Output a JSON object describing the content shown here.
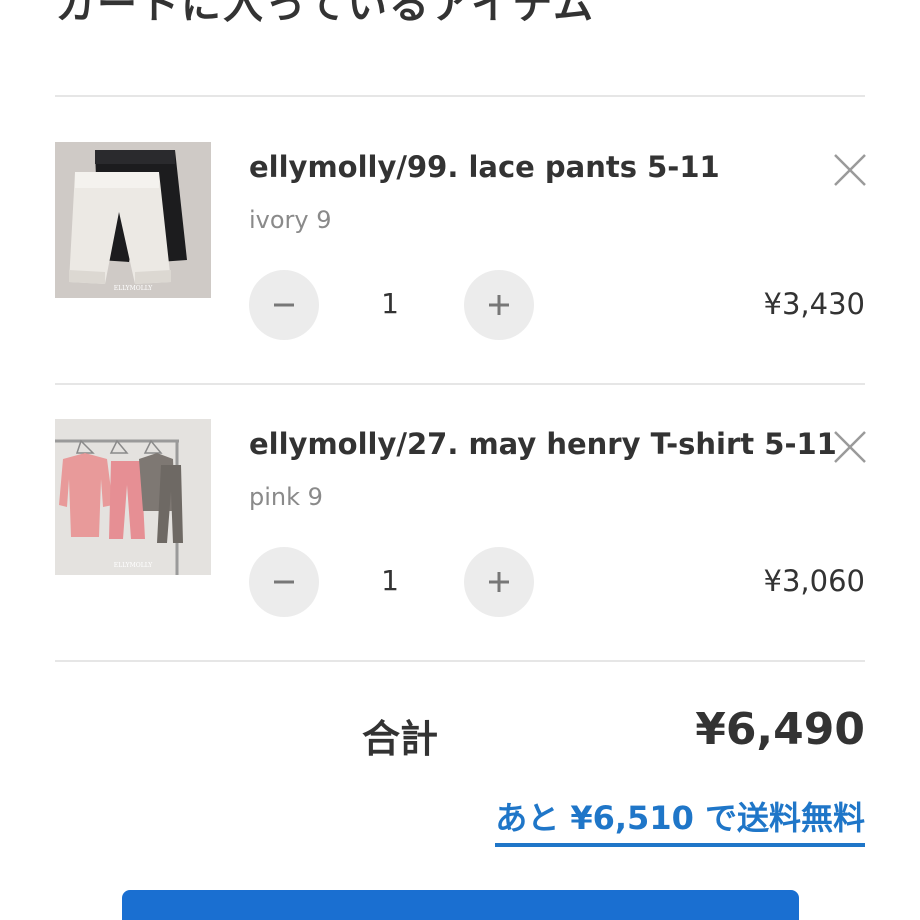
{
  "header": {
    "title": "カートに入っているアイテム"
  },
  "cart": {
    "items": [
      {
        "name": "ellymolly/99. lace pants 5-11",
        "variant": "ivory 9",
        "quantity": "1",
        "price": "¥3,430",
        "image_caption": "ELLYMOLLY"
      },
      {
        "name": "ellymolly/27. may henry T-shirt 5-11",
        "variant": "pink 9",
        "quantity": "1",
        "price": "¥3,060",
        "image_caption": "ELLYMOLLY"
      }
    ]
  },
  "summary": {
    "total_label": "合計",
    "total_value": "¥6,490",
    "free_shipping_notice": "あと ¥6,510 で送料無料"
  },
  "icons": {
    "remove": "close-icon",
    "decrease": "minus-icon",
    "increase": "plus-icon"
  },
  "colors": {
    "accent": "#1f76c8",
    "button": "#1a6fd1",
    "qty_button_bg": "#ececec"
  }
}
